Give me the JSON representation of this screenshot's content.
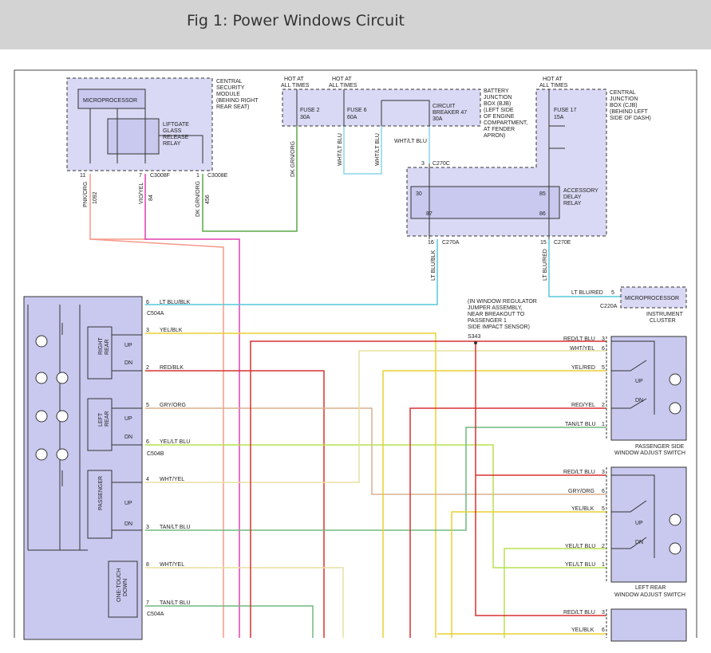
{
  "header": {
    "title": "Fig 1: Power Windows Circuit"
  },
  "colors": {
    "box_fill": "#d9d9f5",
    "wire_pnk_org": "#f59a8a",
    "wire_vio_yel": "#e040b0",
    "wire_dk_grn_org": "#5aa845",
    "wire_wht_lt_blu": "#8ad6ea",
    "wire_lt_blu": "#55c8d8",
    "wire_yel_blk": "#e8d030",
    "wire_red": "#d83030",
    "wire_gry_org": "#d8b090",
    "wire_yel_lt_blu": "#b8e050",
    "wire_wht_yel": "#e8e0a0",
    "wire_tan_lt_blu": "#70b880"
  },
  "security_module": {
    "microprocessor": "MICROPROCESSOR",
    "label_l1": "CENTRAL",
    "label_l2": "SECURITY",
    "label_l3": "MODULE",
    "label_l4": "(BEHIND RIGHT",
    "label_l5": "REAR SEAT)",
    "relay_l1": "LIFTGATE",
    "relay_l2": "GLASS",
    "relay_l3": "RELEASE",
    "relay_l4": "RELAY",
    "pin_11": "11",
    "pin_7": "7",
    "pin_1": "1",
    "conn_c3008f": "C3008F",
    "conn_c3008e": "C3008E",
    "wire1_color": "PNK/ORG",
    "wire1_circuit": "1092",
    "wire2_color": "VIO/YEL",
    "wire2_circuit": "84",
    "wire3_color": "DK GRN/ORG",
    "wire3_circuit": "456"
  },
  "bjb": {
    "hot1_l1": "HOT AT",
    "hot1_l2": "ALL TIMES",
    "hot2_l1": "HOT AT",
    "hot2_l2": "ALL TIMES",
    "fuse2_name": "FUSE 2",
    "fuse2_amp": "30A",
    "fuse6_name": "FUSE 6",
    "fuse6_amp": "60A",
    "cb_l1": "CIRCUIT",
    "cb_l2": "BREAKER 47",
    "cb_l3": "30A",
    "label_l1": "BATTERY",
    "label_l2": "JUNCTION",
    "label_l3": "BOX (BJB)",
    "label_l4": "(LEFT SIDE",
    "label_l5": "OF ENGINE",
    "label_l6": "COMPARTMENT,",
    "label_l7": "AT FENDER",
    "label_l8": "APRON)",
    "wire_dk_grn_org": "DK GRN/ORG",
    "wire_wht_lt_blu_a": "WHT/LT BLU",
    "wire_wht_lt_blu_b": "WHT/LT BLU",
    "wire_wht_lt_blu_c": "WHT/LT BLU"
  },
  "cjb": {
    "hot_l1": "HOT AT",
    "hot_l2": "ALL TIMES",
    "fuse17_name": "FUSE 17",
    "fuse17_amp": "15A",
    "label_l1": "CENTRAL",
    "label_l2": "JUNCTION",
    "label_l3": "BOX (CJB)",
    "label_l4": "(BEHIND LEFT",
    "label_l5": "SIDE OF DASH)",
    "pin_3": "3",
    "conn_c270c": "C270C",
    "relay_l1": "ACCESSORY",
    "relay_l2": "DELAY",
    "relay_l3": "RELAY",
    "r30": "30",
    "r85": "85",
    "r87": "87",
    "r86": "86",
    "pin_16": "16",
    "conn_c270a": "C270A",
    "pin_15": "15",
    "conn_c270e": "C270E",
    "wire_lt_blu_blk": "LT BLU/BLK",
    "wire_lt_blu_red": "LT BLU/RED"
  },
  "cluster": {
    "pin_5": "5",
    "wire": "LT BLU/RED",
    "microprocessor": "MICROPROCESSOR",
    "conn": "C220A",
    "label_l1": "INSTRUMENT",
    "label_l2": "CLUSTER"
  },
  "note": {
    "l1": "(IN WINDOW REGULATOR",
    "l2": "JUMPER ASSEMBLY,",
    "l3": "NEAR BREAKOUT TO",
    "l4": "PASSENGER 1",
    "l5": "SIDE IMPACT SENSOR)",
    "splice": "S343"
  },
  "master_switch": {
    "right_rear_l1": "RIGHT",
    "right_rear_l2": "REAR",
    "left_rear_l1": "LEFT",
    "left_rear_l2": "REAR",
    "passenger": "PASSENGER",
    "one_touch_l1": "ONE-TOUCH",
    "one_touch_l2": "DOWN",
    "up": "UP",
    "dn": "DN",
    "up2": "UP",
    "dn2": "DN",
    "up3": "UP",
    "dn3": "DN"
  },
  "master_pins": {
    "p6a": "6",
    "w6a": "LT BLU/BLK",
    "c504a_top": "C504A",
    "p3a": "3",
    "w3a": "YEL/BLK",
    "p2a": "2",
    "w2a": "RED/BLK",
    "p5a": "5",
    "w5a": "GRY/ORG",
    "p6b": "6",
    "w6b": "YEL/LT BLU",
    "c504b": "C504B",
    "p4": "4",
    "w4": "WHT/YEL",
    "p3b": "3",
    "w3b": "TAN/LT BLU",
    "p8": "8",
    "w8": "WHT/YEL",
    "p7": "7",
    "w7": "TAN/LT BLU",
    "c504a_bot": "C504A"
  },
  "passenger_switch": {
    "p3": "3",
    "w3": "RED/LT BLU",
    "p6": "6",
    "w6": "WHT/YEL",
    "p5": "5",
    "w5": "YEL/RED",
    "p2": "2",
    "w2": "RED/YEL",
    "p1": "1",
    "w1": "TAN/LT BLU",
    "up": "UP",
    "dn": "DN",
    "label_l1": "PASSENGER SIDE",
    "label_l2": "WINDOW ADJUST SWITCH"
  },
  "left_rear_switch": {
    "p3": "3",
    "w3": "RED/LT BLU",
    "p6": "6",
    "w6": "GRY/ORG",
    "p5": "5",
    "w5": "YEL/BLK",
    "p2": "2",
    "w2": "YEL/LT BLU",
    "p1": "1",
    "w1": "YEL/LT BLU",
    "up": "UP",
    "dn": "DN",
    "label_l1": "LEFT REAR",
    "label_l2": "WINDOW ADJUST SWITCH"
  },
  "right_rear_switch": {
    "p3": "3",
    "w3": "RED/LT BLU",
    "p6": "6",
    "w6": "YEL/BLK"
  }
}
